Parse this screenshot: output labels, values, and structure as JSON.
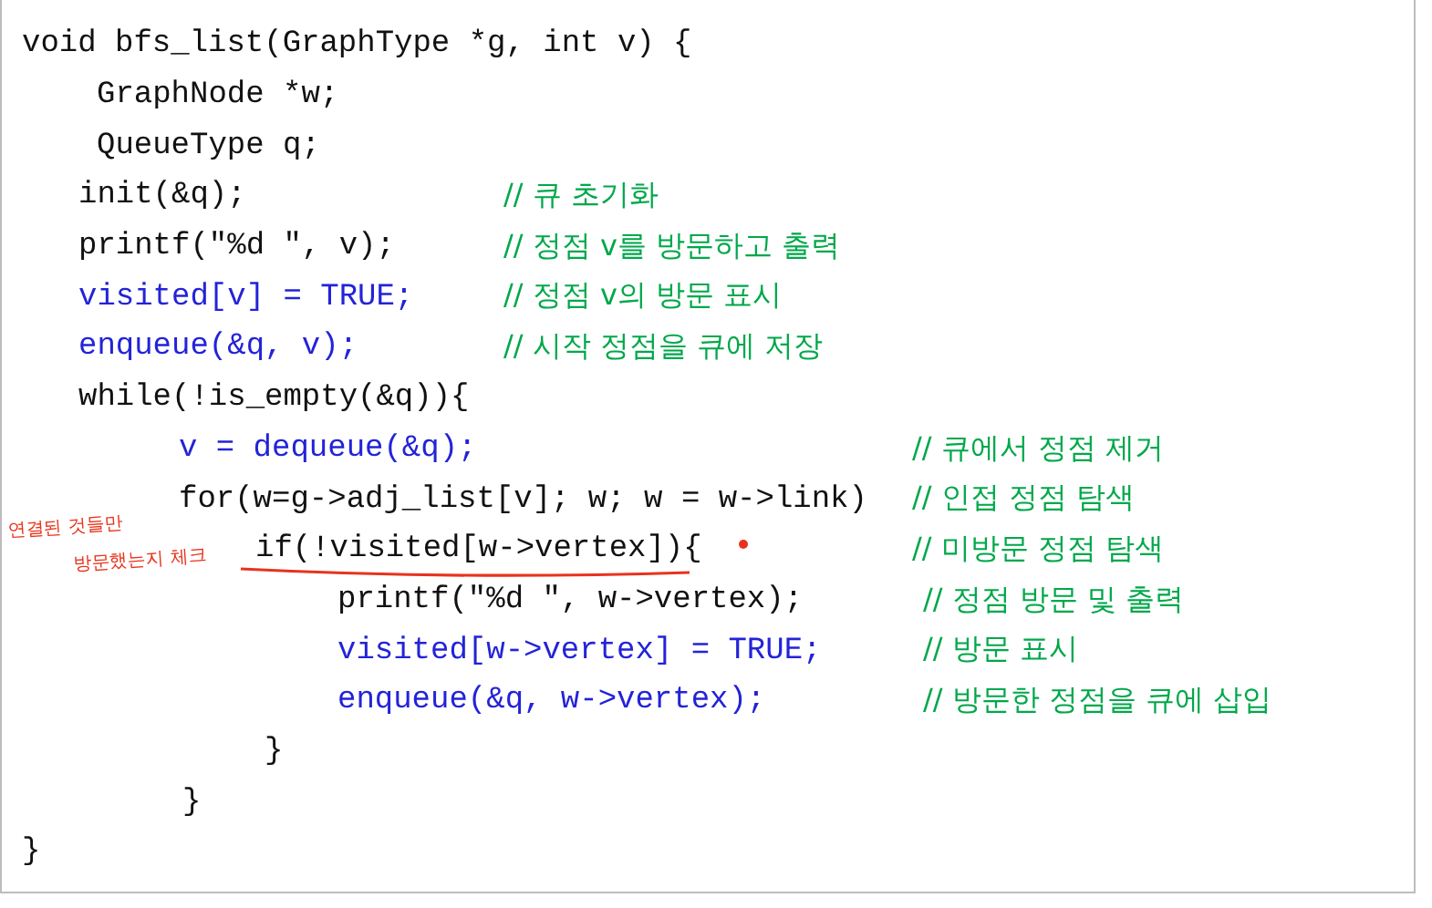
{
  "code_lines": [
    {
      "kind": "head",
      "code": "void bfs_list(GraphType *g, int v) {",
      "highlighted": false
    },
    {
      "kind": "decl",
      "code": "GraphNode *w;",
      "highlighted": false
    },
    {
      "kind": "decl",
      "code": "QueueType q;",
      "highlighted": false
    },
    {
      "kind": "stmt",
      "code": "init(&q);",
      "highlighted": false,
      "comment": "// 큐 초기화"
    },
    {
      "kind": "stmt",
      "code": "printf(\"%d \", v);",
      "highlighted": false,
      "comment": "// 정점 v를 방문하고 출력"
    },
    {
      "kind": "stmt",
      "code": "visited[v] = TRUE;",
      "highlighted": true,
      "comment": "// 정점 v의 방문 표시"
    },
    {
      "kind": "stmt",
      "code": "enqueue(&q, v);",
      "highlighted": true,
      "comment": "// 시작 정점을 큐에 저장"
    },
    {
      "kind": "stmt",
      "code": "while(!is_empty(&q)){",
      "highlighted": false
    },
    {
      "kind": "body",
      "code": "v = dequeue(&q);",
      "highlighted": true,
      "comment": "// 큐에서 정점 제거"
    },
    {
      "kind": "body",
      "code": "for(w=g->adj_list[v]; w; w = w->link)",
      "highlighted": false,
      "comment": "// 인접 정점 탐색"
    },
    {
      "kind": "inner",
      "code": "if(!visited[w->vertex]){",
      "highlighted": false,
      "comment": "// 미방문 정점 탐색",
      "annotation": [
        "연결된 것들만",
        "방문했는지 체크"
      ]
    },
    {
      "kind": "inner2",
      "code": "printf(\"%d \", w->vertex);",
      "highlighted": false,
      "comment": "// 정점 방문 및 출력"
    },
    {
      "kind": "inner2",
      "code": "visited[w->vertex] = TRUE;",
      "highlighted": true,
      "comment": "// 방문 표시"
    },
    {
      "kind": "inner2",
      "code": "enqueue(&q, w->vertex);",
      "highlighted": true,
      "comment": "// 방문한 정점을 큐에 삽입"
    },
    {
      "kind": "close-inner",
      "code": "}",
      "highlighted": false
    },
    {
      "kind": "close-loop",
      "code": "}",
      "highlighted": false
    },
    {
      "kind": "head",
      "code": "}",
      "highlighted": false
    }
  ]
}
